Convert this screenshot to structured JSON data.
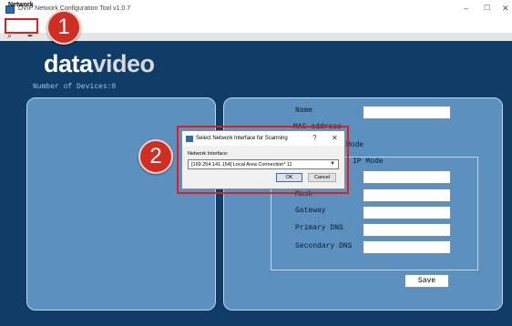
{
  "window": {
    "title": "DVIP Network Configuration Tool v1.0.7",
    "minimize_glyph": "–",
    "maximize_glyph": "☐",
    "close_glyph": "✕"
  },
  "menu": {
    "network_label": "Network"
  },
  "toolbar": {
    "search_icon": "search-icon",
    "brush_icon": "brush-icon"
  },
  "brand": {
    "logo_part1": "data",
    "logo_part2": "video"
  },
  "devices": {
    "count_label": "Number of Devices:0"
  },
  "form": {
    "name_label": "Name",
    "mac_label": "MAC address",
    "mode_label": "Mode",
    "ip_mode_label": "IP Mode",
    "mask_label": "Mask",
    "gateway_label": "Gateway",
    "primary_dns_label": "Primary DNS",
    "secondary_dns_label": "Secondary DNS",
    "save_label": "Save"
  },
  "dialog": {
    "title": "Select Network Interface for Scanning",
    "help_glyph": "?",
    "close_glyph": "✕",
    "interface_label": "Network Interface:",
    "selected_interface": "[169.254.141.154] Local Area Connection* 11",
    "ok_label": "OK",
    "cancel_label": "Cancel"
  },
  "annotations": {
    "step1": "1",
    "step2": "2",
    "highlight_color": "#e21d1d"
  },
  "colors": {
    "app_background": "#0f3d68",
    "panel": "#5b90bf",
    "badge": "#cf2e24"
  }
}
